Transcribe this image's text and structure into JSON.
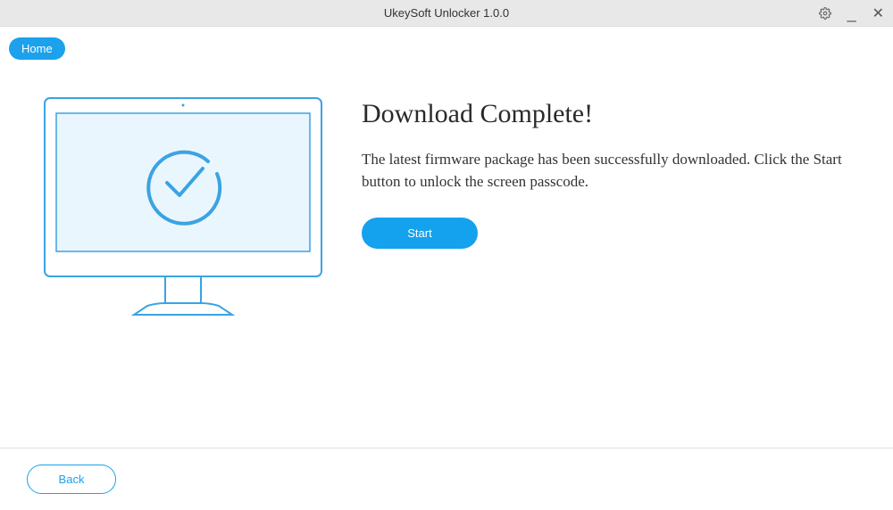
{
  "titlebar": {
    "title": "UkeySoft Unlocker 1.0.0"
  },
  "nav": {
    "home_label": "Home"
  },
  "main": {
    "headline": "Download Complete!",
    "description": "The latest firmware package has been successfully downloaded. Click the Start button to unlock the screen passcode.",
    "start_label": "Start"
  },
  "footer": {
    "back_label": "Back"
  },
  "icons": {
    "settings": "settings-icon",
    "minimize": "minimize-icon",
    "close": "close-icon",
    "monitor_check": "monitor-checkmark-illustration"
  },
  "colors": {
    "accent": "#1ca1ed",
    "titlebar_bg": "#e8e8e8",
    "illustration_stroke": "#3aa3e3",
    "illustration_fill": "#eaf6fd"
  }
}
